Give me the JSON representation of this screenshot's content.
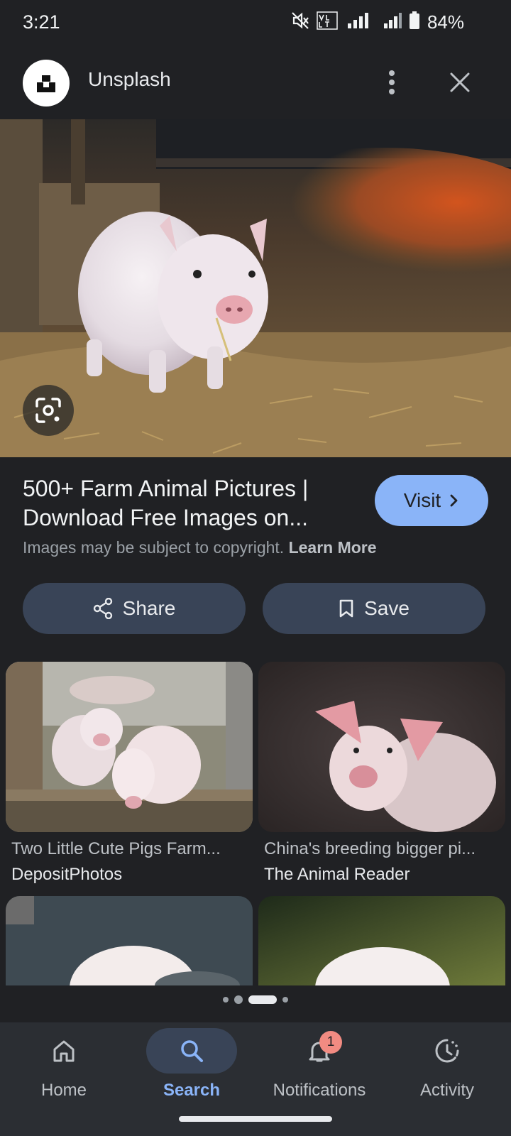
{
  "status": {
    "time": "3:21",
    "battery": "84%",
    "icons": [
      "mute-icon",
      "volte-icon",
      "signal-icon",
      "signal-icon",
      "battery-icon"
    ]
  },
  "header": {
    "site_name": "Unsplash",
    "menu_icon": "more-vert-icon",
    "close_icon": "close-icon"
  },
  "result": {
    "title": "500+ Farm Animal Pictures | Download Free Images on...",
    "visit_label": "Visit",
    "copyright_text": "Images may be subject to copyright.",
    "learn_more": "Learn More",
    "share_label": "Share",
    "save_label": "Save"
  },
  "related": [
    {
      "caption": "Two Little Cute Pigs Farm...",
      "source": "DepositPhotos"
    },
    {
      "caption": "China's breeding bigger pi...",
      "source": "The Animal Reader"
    }
  ],
  "pager": {
    "count": 4,
    "active": 2
  },
  "nav": {
    "items": [
      {
        "label": "Home",
        "icon": "home-icon"
      },
      {
        "label": "Search",
        "icon": "search-icon"
      },
      {
        "label": "Notifications",
        "icon": "bell-icon"
      },
      {
        "label": "Activity",
        "icon": "activity-icon"
      }
    ],
    "active": "Search",
    "notifications_badge": "1"
  },
  "colors": {
    "background": "#202124",
    "accent": "#8ab4f8",
    "button": "#394457",
    "badge": "#f28b82"
  }
}
